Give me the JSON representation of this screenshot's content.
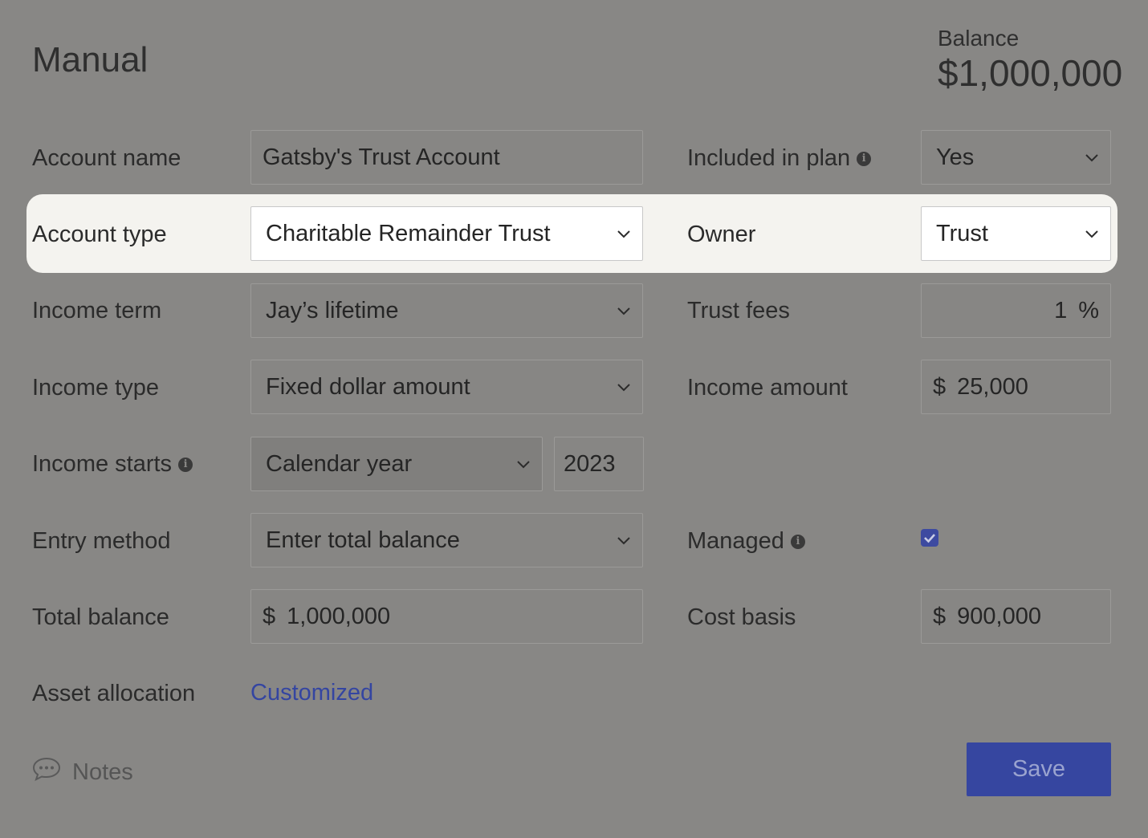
{
  "header": {
    "title": "Manual",
    "balance_label": "Balance",
    "balance_value": "$1,000,000"
  },
  "left": {
    "account_name": {
      "label": "Account name",
      "value": "Gatsby's Trust Account"
    },
    "account_type": {
      "label": "Account type",
      "value": "Charitable Remainder Trust"
    },
    "income_term": {
      "label": "Income term",
      "value": "Jay’s lifetime"
    },
    "income_type": {
      "label": "Income type",
      "value": "Fixed dollar amount"
    },
    "income_starts": {
      "label": "Income starts",
      "value": "Calendar year",
      "year": "2023"
    },
    "entry_method": {
      "label": "Entry method",
      "value": "Enter total balance"
    },
    "total_balance": {
      "label": "Total balance",
      "prefix": "$",
      "value": "1,000,000"
    },
    "asset_allocation": {
      "label": "Asset allocation",
      "value": "Customized"
    }
  },
  "right": {
    "included_in_plan": {
      "label": "Included in plan",
      "value": "Yes"
    },
    "owner": {
      "label": "Owner",
      "value": "Trust"
    },
    "trust_fees": {
      "label": "Trust fees",
      "value": "1",
      "suffix": "%"
    },
    "income_amount": {
      "label": "Income amount",
      "prefix": "$",
      "value": "25,000"
    },
    "managed": {
      "label": "Managed",
      "checked": true
    },
    "cost_basis": {
      "label": "Cost basis",
      "prefix": "$",
      "value": "900,000"
    }
  },
  "footer": {
    "notes_label": "Notes",
    "save_label": "Save"
  },
  "colors": {
    "accent": "#3646a0",
    "highlight": "#f4f3ef",
    "overlay": "#888785"
  }
}
